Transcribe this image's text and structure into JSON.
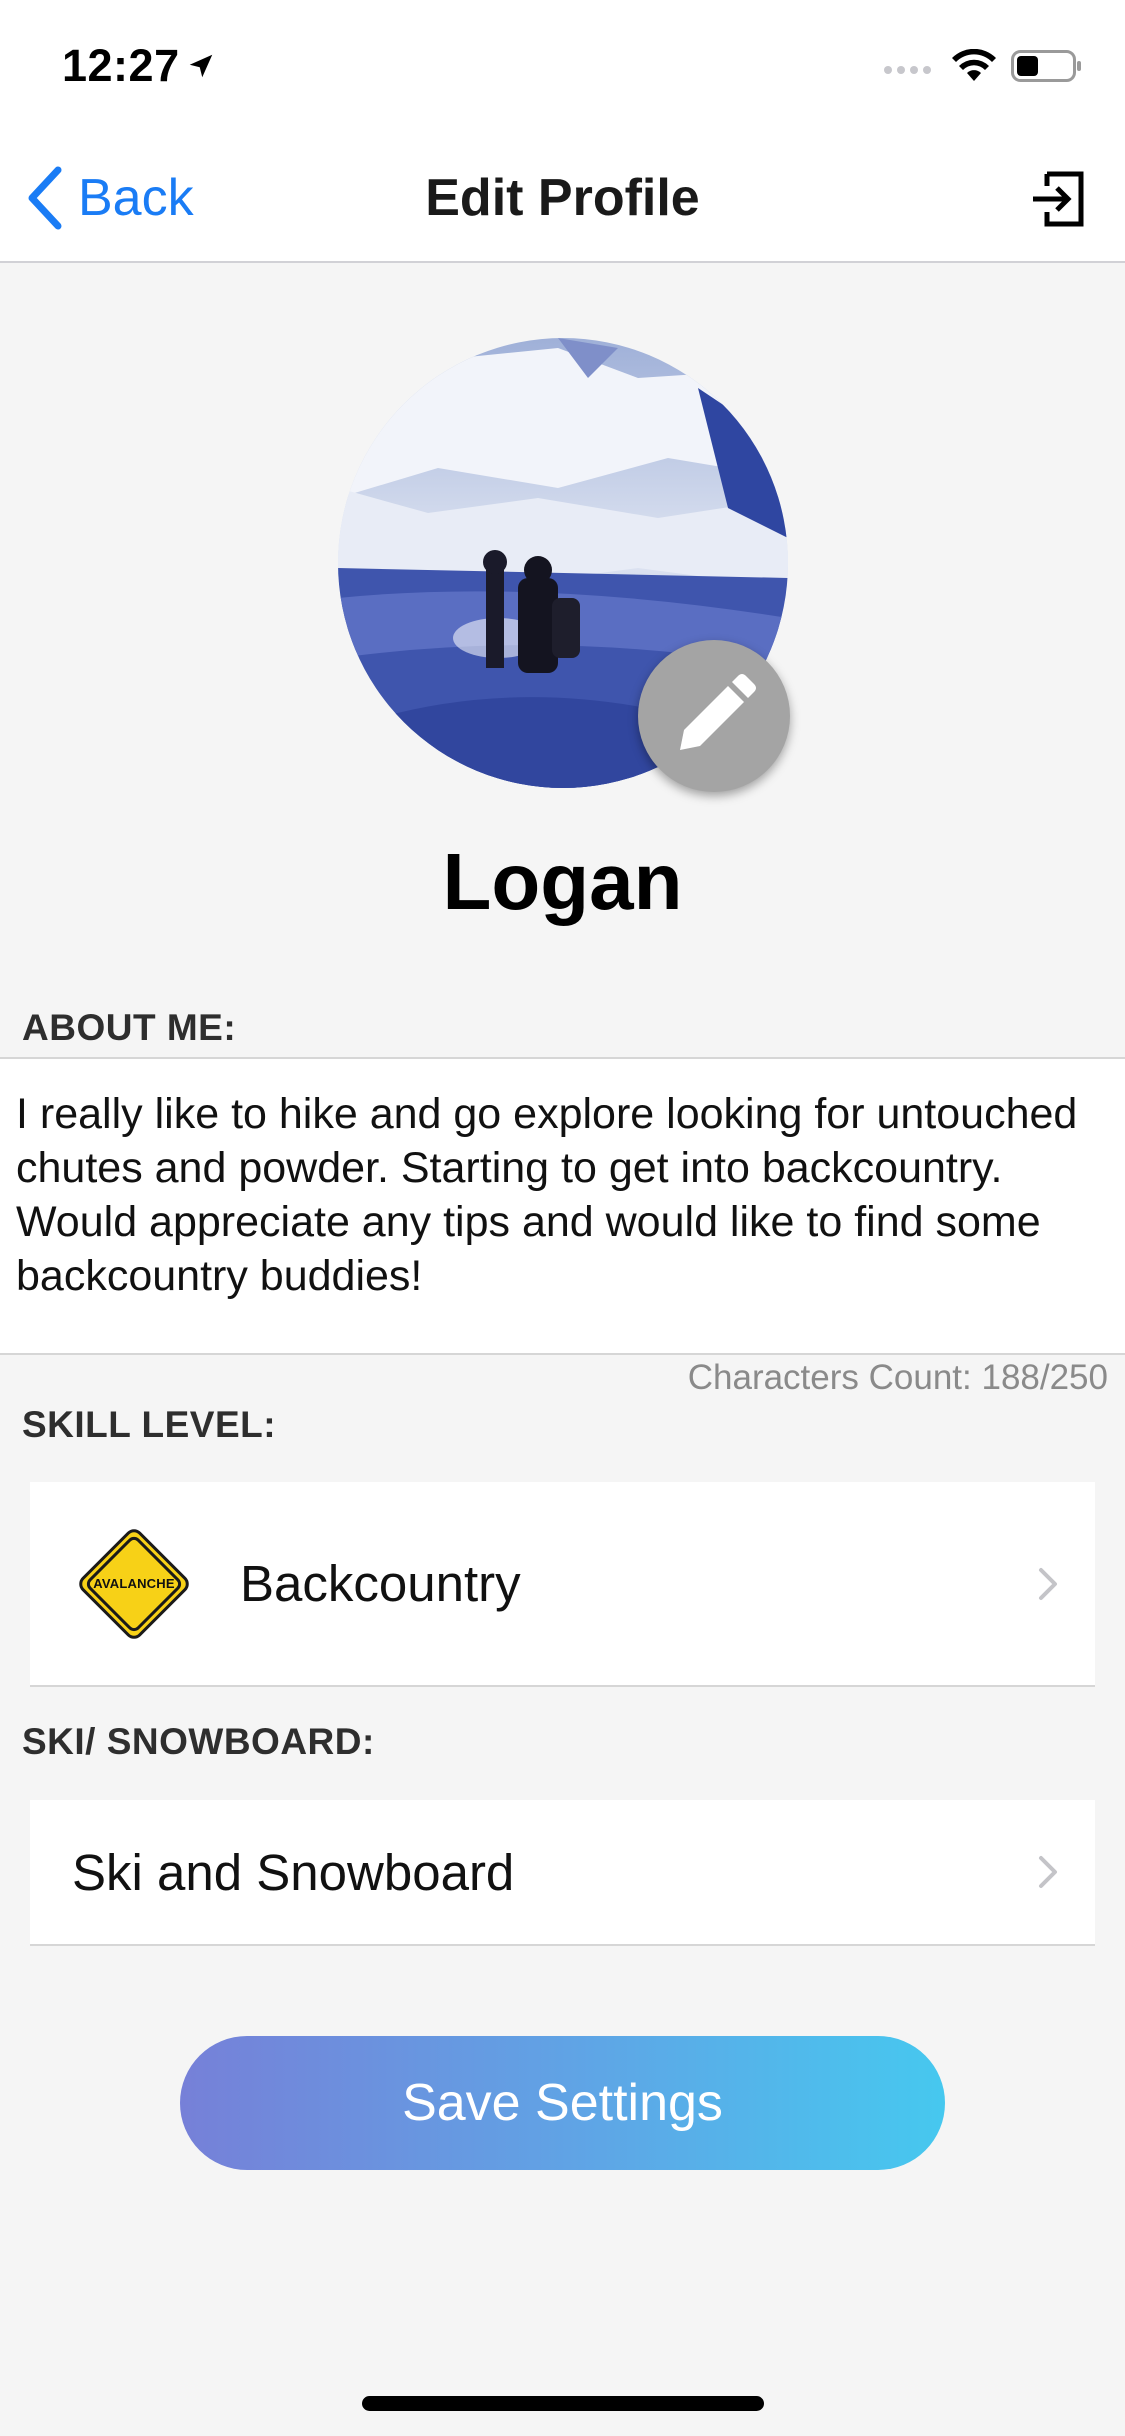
{
  "status_bar": {
    "time": "12:27",
    "location_icon": "location-arrow-icon",
    "signal_icon": "cellular-signal-icon",
    "wifi_icon": "wifi-icon",
    "battery_icon": "battery-icon"
  },
  "nav": {
    "back_label": "Back",
    "title": "Edit Profile",
    "logout_icon": "logout-icon"
  },
  "profile": {
    "name": "Logan",
    "edit_icon": "pencil-icon"
  },
  "about": {
    "label": "ABOUT ME:",
    "text": "I really like to hike and go explore looking for untouched chutes and powder.  Starting to get into backcountry.  Would appreciate any tips and would like to find some backcountry buddies!",
    "char_count": "Characters Count: 188/250"
  },
  "skill": {
    "label": "SKILL LEVEL:",
    "value": "Backcountry",
    "badge_text": "AVALANCHE",
    "badge_icon": "avalanche-sign-icon"
  },
  "sport": {
    "label": "SKI/ SNOWBOARD:",
    "value": "Ski and Snowboard"
  },
  "actions": {
    "save_label": "Save Settings"
  },
  "colors": {
    "accent": "#1a7cf5",
    "background": "#f5f5f5",
    "button_gradient_start": "#7680d8",
    "button_gradient_end": "#46c8ef",
    "badge_yellow": "#f7d117"
  }
}
